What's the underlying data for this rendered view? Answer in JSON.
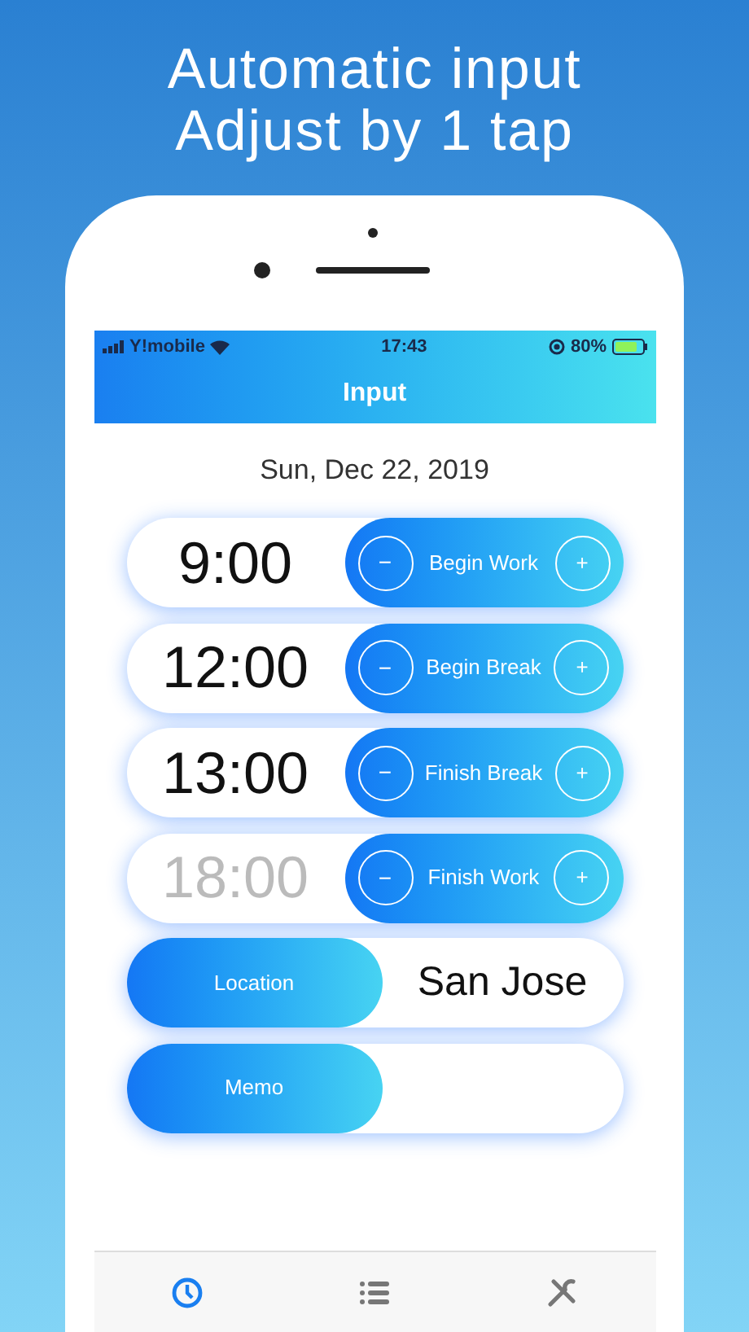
{
  "headline": [
    "Automatic input",
    "Adjust by 1 tap"
  ],
  "status_bar": {
    "carrier": "Y!mobile",
    "time": "17:43",
    "battery": "80%"
  },
  "nav": {
    "title": "Input"
  },
  "date": "Sun, Dec 22, 2019",
  "time_rows": [
    {
      "time": "9:00",
      "label": "Begin Work",
      "minus": "−",
      "plus": "+",
      "confirmed": true
    },
    {
      "time": "12:00",
      "label": "Begin Break",
      "minus": "−",
      "plus": "+",
      "confirmed": true
    },
    {
      "time": "13:00",
      "label": "Finish Break",
      "minus": "−",
      "plus": "+",
      "confirmed": true
    },
    {
      "time": "18:00",
      "label": "Finish Work",
      "minus": "−",
      "plus": "+",
      "confirmed": false
    }
  ],
  "fields": [
    {
      "label": "Location",
      "value": "San Jose"
    },
    {
      "label": "Memo"
    }
  ],
  "tabs": [
    {
      "kind": "clock",
      "selected": true
    },
    {
      "kind": "list",
      "selected": false
    },
    {
      "kind": "tools",
      "selected": false
    }
  ]
}
